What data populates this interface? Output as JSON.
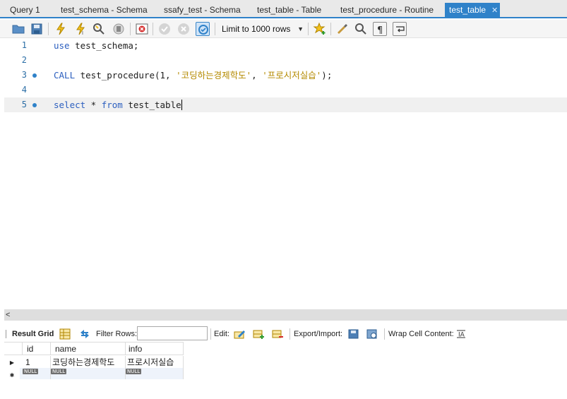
{
  "tabs": [
    {
      "label": "Query 1",
      "active": false
    },
    {
      "label": "test_schema - Schema",
      "active": false
    },
    {
      "label": "ssafy_test - Schema",
      "active": false
    },
    {
      "label": "test_table - Table",
      "active": false
    },
    {
      "label": "test_procedure - Routine",
      "active": false
    },
    {
      "label": "test_table",
      "active": true
    }
  ],
  "toolbar": {
    "icons": [
      "open-folder-icon",
      "save-icon",
      "execute-icon",
      "execute-current-icon",
      "explain-icon",
      "stop-icon",
      "toggle-error-icon",
      "commit-icon",
      "rollback-icon",
      "autocommit-icon",
      "favorite-add-icon",
      "beautify-icon",
      "find-icon",
      "invisible-chars-icon",
      "wrap-icon"
    ],
    "limit_label": "Limit to 1000 rows"
  },
  "editor": {
    "lines": [
      {
        "number": "1",
        "dot": false,
        "tokens": [
          {
            "t": "use",
            "c": "kw"
          },
          {
            "t": " test_schema;",
            "c": ""
          }
        ]
      },
      {
        "number": "2",
        "dot": false,
        "tokens": []
      },
      {
        "number": "3",
        "dot": true,
        "tokens": [
          {
            "t": "CALL",
            "c": "kw"
          },
          {
            "t": " test_procedure(1, ",
            "c": ""
          },
          {
            "t": "'코딩하는경제학도'",
            "c": "str"
          },
          {
            "t": ", ",
            "c": ""
          },
          {
            "t": "'프로시저실습'",
            "c": "str"
          },
          {
            "t": ");",
            "c": ""
          }
        ]
      },
      {
        "number": "4",
        "dot": false,
        "tokens": []
      },
      {
        "number": "5",
        "dot": true,
        "tokens": [
          {
            "t": "select",
            "c": "kw"
          },
          {
            "t": " * ",
            "c": ""
          },
          {
            "t": "from",
            "c": "kw"
          },
          {
            "t": " test_table",
            "c": ""
          }
        ],
        "current": true
      }
    ]
  },
  "result_toolbar": {
    "result_grid_label": "Result Grid",
    "filter_rows_label": "Filter Rows:",
    "filter_value": "",
    "edit_label": "Edit:",
    "export_label": "Export/Import:",
    "wrap_label": "Wrap Cell Content:"
  },
  "grid": {
    "columns": [
      "id",
      "name",
      "info"
    ],
    "rows": [
      [
        "1",
        "코딩하는경제학도",
        "프로시저실습"
      ]
    ],
    "null_label": "NULL"
  },
  "colors": {
    "accent": "#2f82c9",
    "keyword": "#2c5fbf",
    "string": "#b48a00"
  }
}
